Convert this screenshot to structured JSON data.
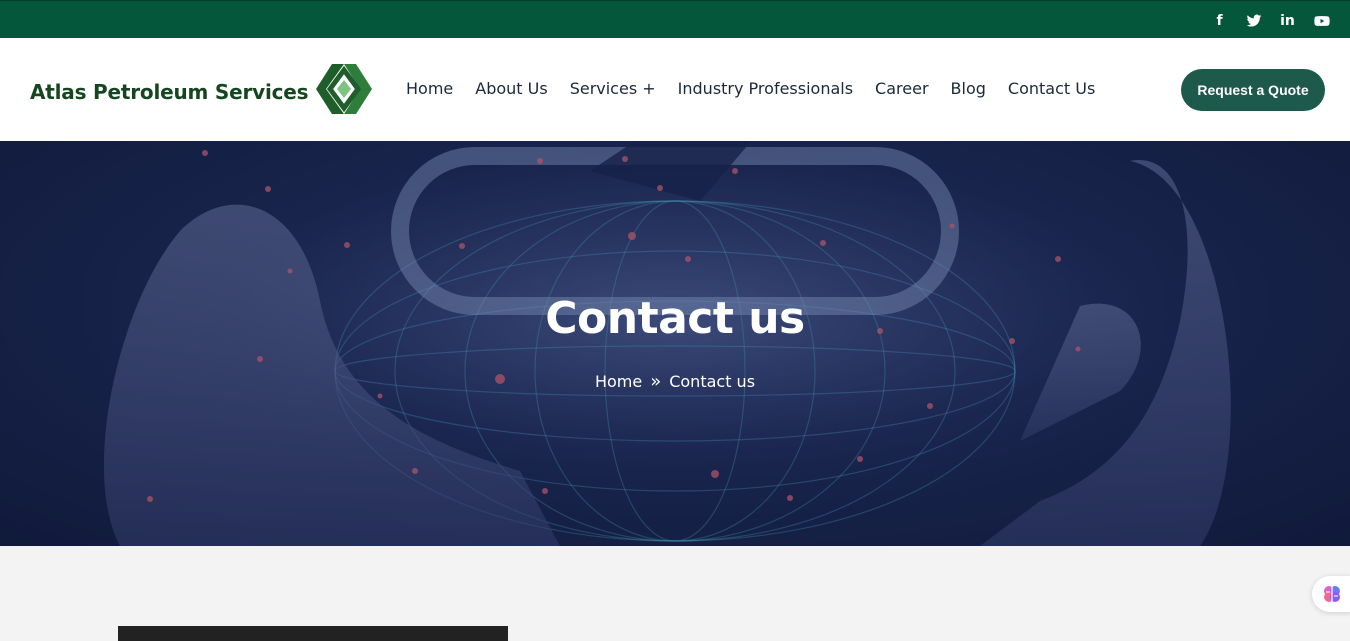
{
  "social": {
    "icons": [
      "facebook-icon",
      "twitter-icon",
      "linkedin-icon",
      "youtube-icon"
    ],
    "facebook_glyph": "f",
    "linkedin_glyph": "in"
  },
  "header": {
    "logo_text": "Atlas Petroleum Services",
    "nav": [
      "Home",
      "About Us",
      "Services +",
      "Industry Professionals",
      "Career",
      "Blog",
      "Contact Us"
    ],
    "quote_button": "Request a Quote"
  },
  "hero": {
    "title": "Contact us",
    "breadcrumb_home": "Home",
    "breadcrumb_separator": "»",
    "breadcrumb_current": "Contact us"
  },
  "colors": {
    "topbar": "#04573b",
    "accent_button": "#1e5a4c",
    "logo_green": "#16461f",
    "hero_dark": "#1d2a55"
  }
}
